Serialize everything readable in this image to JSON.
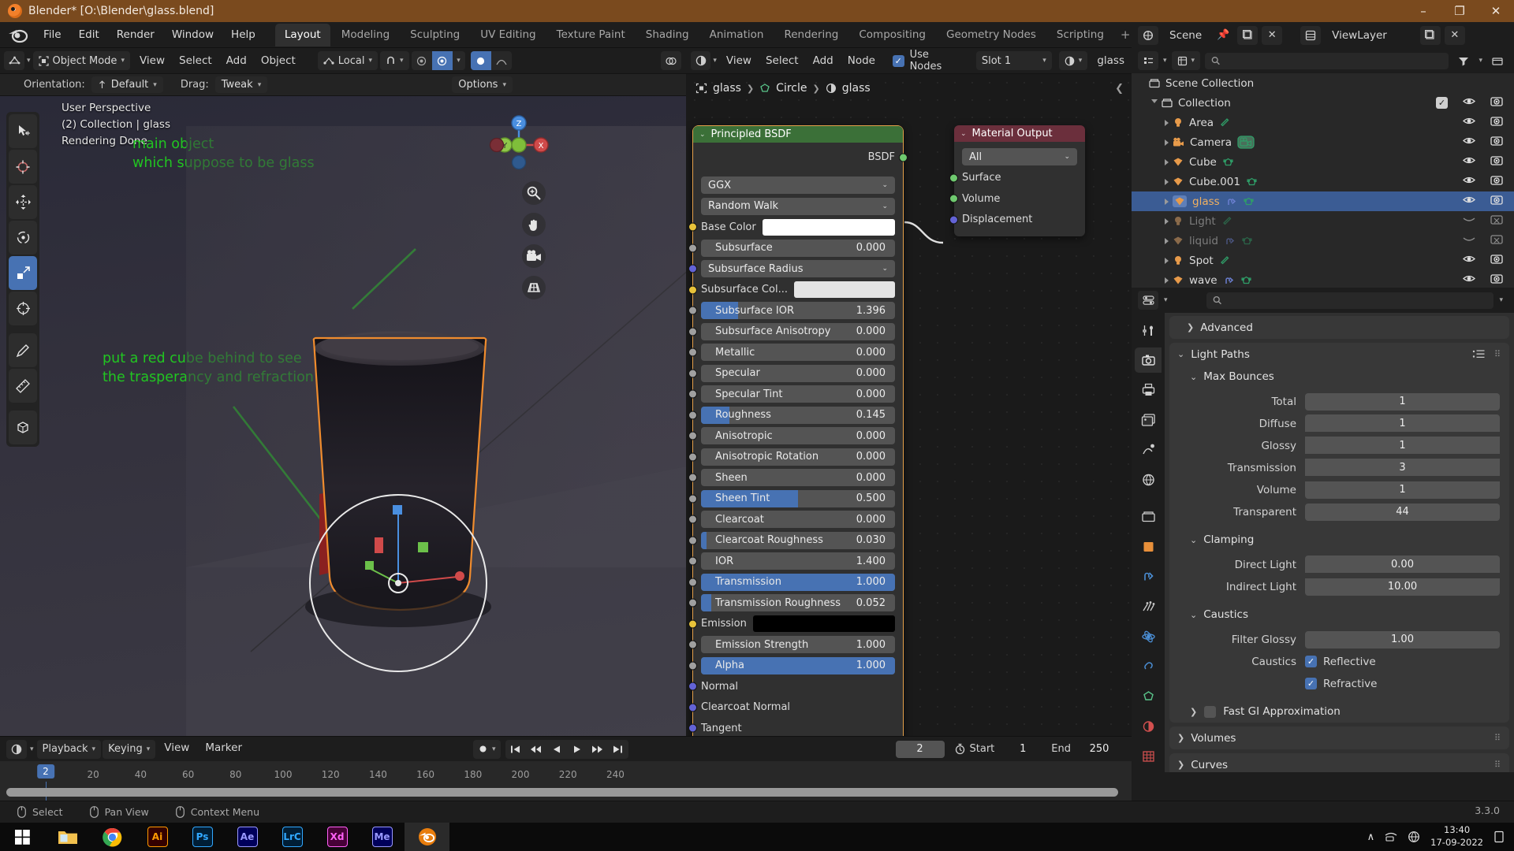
{
  "window": {
    "title": "Blender* [O:\\Blender\\glass.blend]",
    "minimize": "–",
    "maximize": "❐",
    "close": "✕"
  },
  "topbar": {
    "menus": [
      "File",
      "Edit",
      "Render",
      "Window",
      "Help"
    ],
    "workspaces": [
      "Layout",
      "Modeling",
      "Sculpting",
      "UV Editing",
      "Texture Paint",
      "Shading",
      "Animation",
      "Rendering",
      "Compositing",
      "Geometry Nodes",
      "Scripting"
    ],
    "active_workspace": "Layout",
    "add_workspace": "+",
    "scene_label": "Scene",
    "viewlayer_label": "ViewLayer"
  },
  "viewport_header": {
    "mode": "Object Mode",
    "menus": [
      "View",
      "Select",
      "Add",
      "Object"
    ],
    "transform_orientation": "Local"
  },
  "tool_settings": {
    "orientation_label": "Orientation:",
    "orientation_value": "Default",
    "drag_label": "Drag:",
    "drag_value": "Tweak",
    "options_label": "Options"
  },
  "viewport": {
    "overlay_line1": "User Perspective",
    "overlay_line2": "(2) Collection | glass",
    "overlay_line3": "Rendering Done",
    "annotation1": "main object\nwhich suppose to be glass",
    "annotation2": "put a red cube behind to see\nthe trasperancy and refraction",
    "annotation_color": "#21c521",
    "gizmo_axes": [
      "X",
      "Y",
      "Z"
    ]
  },
  "shader_editor": {
    "menus": [
      "View",
      "Select",
      "Add",
      "Node"
    ],
    "use_nodes_label": "Use Nodes",
    "use_nodes_checked": true,
    "slot": "Slot 1",
    "material": "glass",
    "breadcrumb": [
      "glass",
      "Circle",
      "glass"
    ],
    "nodes": [
      {
        "title": "Principled BSDF",
        "header_color": "#3b7038",
        "output_label": "BSDF",
        "dropdowns": [
          "GGX",
          "Random Walk"
        ],
        "rows": [
          {
            "label": "Base Color",
            "type": "color",
            "color": "#ffffff",
            "sock": "#e8c33a"
          },
          {
            "label": "Subsurface",
            "type": "slider",
            "value": "0.000",
            "fill": 0,
            "indent": true,
            "sock": "#a0a0a0"
          },
          {
            "label": "Subsurface Radius",
            "type": "dropdown",
            "sock": "#6363d6"
          },
          {
            "label": "Subsurface Col...",
            "type": "color",
            "color": "#e4e4e4",
            "sock": "#e8c33a"
          },
          {
            "label": "Subsurface IOR",
            "type": "slider",
            "value": "1.396",
            "fill": 19,
            "indent": true,
            "sock": "#a0a0a0"
          },
          {
            "label": "Subsurface Anisotropy",
            "type": "slider",
            "value": "0.000",
            "fill": 0,
            "indent": true,
            "sock": "#a0a0a0"
          },
          {
            "label": "Metallic",
            "type": "slider",
            "value": "0.000",
            "fill": 0,
            "indent": true,
            "sock": "#a0a0a0"
          },
          {
            "label": "Specular",
            "type": "slider",
            "value": "0.000",
            "fill": 0,
            "indent": true,
            "sock": "#a0a0a0"
          },
          {
            "label": "Specular Tint",
            "type": "slider",
            "value": "0.000",
            "fill": 0,
            "indent": true,
            "sock": "#a0a0a0"
          },
          {
            "label": "Roughness",
            "type": "slider",
            "value": "0.145",
            "fill": 14.5,
            "indent": true,
            "sock": "#a0a0a0"
          },
          {
            "label": "Anisotropic",
            "type": "slider",
            "value": "0.000",
            "fill": 0,
            "indent": true,
            "sock": "#a0a0a0"
          },
          {
            "label": "Anisotropic Rotation",
            "type": "slider",
            "value": "0.000",
            "fill": 0,
            "indent": true,
            "sock": "#a0a0a0"
          },
          {
            "label": "Sheen",
            "type": "slider",
            "value": "0.000",
            "fill": 0,
            "indent": true,
            "sock": "#a0a0a0"
          },
          {
            "label": "Sheen Tint",
            "type": "slider",
            "value": "0.500",
            "fill": 50,
            "indent": true,
            "sock": "#a0a0a0"
          },
          {
            "label": "Clearcoat",
            "type": "slider",
            "value": "0.000",
            "fill": 0,
            "indent": true,
            "sock": "#a0a0a0"
          },
          {
            "label": "Clearcoat Roughness",
            "type": "slider",
            "value": "0.030",
            "fill": 3,
            "indent": true,
            "sock": "#a0a0a0"
          },
          {
            "label": "IOR",
            "type": "slider",
            "value": "1.400",
            "fill": 0,
            "indent": true,
            "sock": "#a0a0a0"
          },
          {
            "label": "Transmission",
            "type": "slider",
            "value": "1.000",
            "fill": 100,
            "indent": true,
            "sock": "#a0a0a0"
          },
          {
            "label": "Transmission Roughness",
            "type": "slider",
            "value": "0.052",
            "fill": 5.2,
            "indent": true,
            "sock": "#a0a0a0"
          },
          {
            "label": "Emission",
            "type": "color",
            "color": "#000000",
            "sock": "#e8c33a"
          },
          {
            "label": "Emission Strength",
            "type": "slider",
            "value": "1.000",
            "fill": 0,
            "indent": true,
            "sock": "#a0a0a0"
          },
          {
            "label": "Alpha",
            "type": "slider",
            "value": "1.000",
            "fill": 100,
            "indent": true,
            "sock": "#a0a0a0"
          },
          {
            "label": "Normal",
            "type": "plain",
            "sock": "#6363d6"
          },
          {
            "label": "Clearcoat Normal",
            "type": "plain",
            "sock": "#6363d6"
          },
          {
            "label": "Tangent",
            "type": "plain",
            "sock": "#6363d6"
          }
        ]
      },
      {
        "title": "Material Output",
        "header_color": "#6b2f3c",
        "dropdowns": [
          "All"
        ],
        "rows": [
          {
            "label": "Surface",
            "type": "plain",
            "sock": "#6fc96f"
          },
          {
            "label": "Volume",
            "type": "plain",
            "sock": "#6fc96f"
          },
          {
            "label": "Displacement",
            "type": "plain",
            "sock": "#6363d6"
          }
        ]
      }
    ]
  },
  "outliner": {
    "search_placeholder": "",
    "root": "Scene Collection",
    "items": [
      {
        "name": "Collection",
        "depth": 1,
        "icon": "collection-icon",
        "icon_color": "#cfcfcf",
        "disabled": false,
        "selected": false,
        "checkbox": true,
        "eye": true,
        "camera": true,
        "badges": []
      },
      {
        "name": "Area",
        "depth": 2,
        "icon": "light-icon",
        "icon_color": "#e79a4a",
        "disabled": false,
        "selected": false,
        "checkbox": false,
        "eye": true,
        "camera": true,
        "badges": [
          "light-data-icon"
        ]
      },
      {
        "name": "Camera",
        "depth": 2,
        "icon": "camera-icon",
        "icon_color": "#e79a4a",
        "disabled": false,
        "selected": false,
        "checkbox": false,
        "eye": true,
        "camera": true,
        "badges": [
          "camera-data-icon"
        ]
      },
      {
        "name": "Cube",
        "depth": 2,
        "icon": "mesh-icon",
        "icon_color": "#e79a4a",
        "disabled": false,
        "selected": false,
        "checkbox": false,
        "eye": true,
        "camera": true,
        "badges": [
          "mesh-data-icon"
        ]
      },
      {
        "name": "Cube.001",
        "depth": 2,
        "icon": "mesh-icon",
        "icon_color": "#e79a4a",
        "disabled": false,
        "selected": false,
        "checkbox": false,
        "eye": true,
        "camera": true,
        "badges": [
          "mesh-data-icon"
        ]
      },
      {
        "name": "glass",
        "depth": 2,
        "icon": "mesh-icon",
        "icon_color": "#e79a4a",
        "disabled": false,
        "selected": true,
        "checkbox": false,
        "eye": true,
        "camera": true,
        "badges": [
          "modifier-icon",
          "mesh-data-icon"
        ]
      },
      {
        "name": "Light",
        "depth": 2,
        "icon": "light-icon",
        "icon_color": "#8a6a4a",
        "disabled": true,
        "selected": false,
        "checkbox": false,
        "eye": false,
        "camera": false,
        "badges": [
          "light-data-icon"
        ]
      },
      {
        "name": "liquid",
        "depth": 2,
        "icon": "mesh-icon",
        "icon_color": "#8a6a4a",
        "disabled": true,
        "selected": false,
        "checkbox": false,
        "eye": false,
        "camera": false,
        "badges": [
          "modifier-icon",
          "mesh-data-icon"
        ]
      },
      {
        "name": "Spot",
        "depth": 2,
        "icon": "light-icon",
        "icon_color": "#e79a4a",
        "disabled": false,
        "selected": false,
        "checkbox": false,
        "eye": true,
        "camera": true,
        "badges": [
          "light-data-icon"
        ]
      },
      {
        "name": "wave",
        "depth": 2,
        "icon": "mesh-icon",
        "icon_color": "#e79a4a",
        "disabled": false,
        "selected": false,
        "checkbox": false,
        "eye": true,
        "camera": true,
        "badges": [
          "modifier-icon",
          "mesh-data-icon"
        ]
      }
    ]
  },
  "properties": {
    "search_placeholder": "",
    "advanced_label": "Advanced",
    "light_paths_label": "Light Paths",
    "max_bounces_label": "Max Bounces",
    "max_bounces": [
      {
        "label": "Total",
        "value": "1"
      },
      {
        "label": "Diffuse",
        "value": "1"
      },
      {
        "label": "Glossy",
        "value": "1"
      },
      {
        "label": "Transmission",
        "value": "3"
      },
      {
        "label": "Volume",
        "value": "1"
      },
      {
        "label": "Transparent",
        "value": "44"
      }
    ],
    "clamping_label": "Clamping",
    "clamping": [
      {
        "label": "Direct Light",
        "value": "0.00"
      },
      {
        "label": "Indirect Light",
        "value": "10.00"
      }
    ],
    "caustics_label": "Caustics",
    "filter_glossy_label": "Filter Glossy",
    "filter_glossy_value": "1.00",
    "caustics_row_label": "Caustics",
    "caustics_reflective_label": "Reflective",
    "caustics_reflective_checked": true,
    "caustics_refractive_label": "Refractive",
    "caustics_refractive_checked": true,
    "fast_gi_label": "Fast GI Approximation",
    "fast_gi_checked": false,
    "volumes_label": "Volumes",
    "curves_label": "Curves"
  },
  "timeline": {
    "menus": [
      "Playback",
      "Keying",
      "View",
      "Marker"
    ],
    "current_frame": "2",
    "start_label": "Start",
    "start_value": "1",
    "end_label": "End",
    "end_value": "250",
    "ticks": [
      "20",
      "40",
      "60",
      "80",
      "100",
      "120",
      "140",
      "160",
      "180",
      "200",
      "220",
      "240"
    ]
  },
  "statusbar": {
    "items": [
      "Select",
      "Pan View",
      "Context Menu"
    ],
    "version": "3.3.0"
  },
  "taskbar": {
    "apps": [
      {
        "name": "start-button",
        "label": "",
        "color": "#0b0b0b"
      },
      {
        "name": "file-explorer",
        "label": "",
        "color": "#f0b429"
      },
      {
        "name": "chrome",
        "label": "",
        "color": "#ffffff"
      },
      {
        "name": "illustrator",
        "label": "Ai",
        "color": "#330000"
      },
      {
        "name": "photoshop",
        "label": "Ps",
        "color": "#001e36"
      },
      {
        "name": "after-effects",
        "label": "Ae",
        "color": "#00005b"
      },
      {
        "name": "lightroom-classic",
        "label": "LrC",
        "color": "#001e36"
      },
      {
        "name": "adobe-xd",
        "label": "Xd",
        "color": "#470137"
      },
      {
        "name": "media-encoder",
        "label": "Me",
        "color": "#00005b"
      },
      {
        "name": "blender",
        "label": "",
        "color": "#2a2a2a"
      }
    ],
    "time": "13:40",
    "date": "17-09-2022"
  }
}
